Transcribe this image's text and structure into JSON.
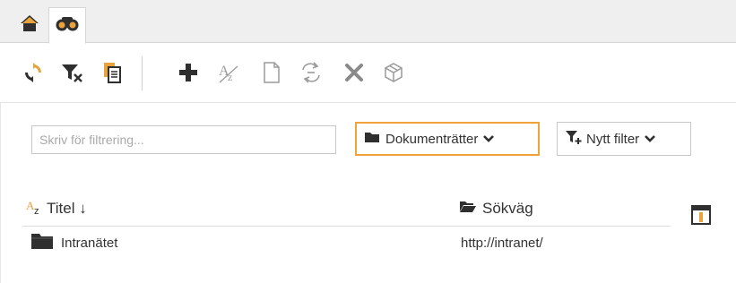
{
  "tabs": [
    {
      "icon": "home-icon",
      "active": false
    },
    {
      "icon": "binoculars-icon",
      "active": true
    }
  ],
  "toolbar": {
    "icons": [
      "refresh-icon",
      "clear-filter-icon",
      "copy-icon",
      "add-icon",
      "rename-icon",
      "new-document-icon",
      "move-icon",
      "delete-icon",
      "package-icon"
    ]
  },
  "filter": {
    "placeholder": "Skriv för filtrering..."
  },
  "dropdowns": {
    "scope_label": "Dokumenträtter",
    "new_filter_label": "Nytt filter"
  },
  "table": {
    "columns": [
      {
        "label": "Titel ↓",
        "icon": "text-icon"
      },
      {
        "label": "Sökväg",
        "icon": "folder-open-icon"
      }
    ],
    "rows": [
      {
        "title": "Intranätet",
        "path": "http://intranet/",
        "icon": "folder-icon"
      }
    ]
  },
  "colors": {
    "accent": "#f1a33a",
    "icon_dark": "#2f2f2f",
    "icon_orange": "#e8a33d",
    "tabstrip": "#efefef"
  }
}
